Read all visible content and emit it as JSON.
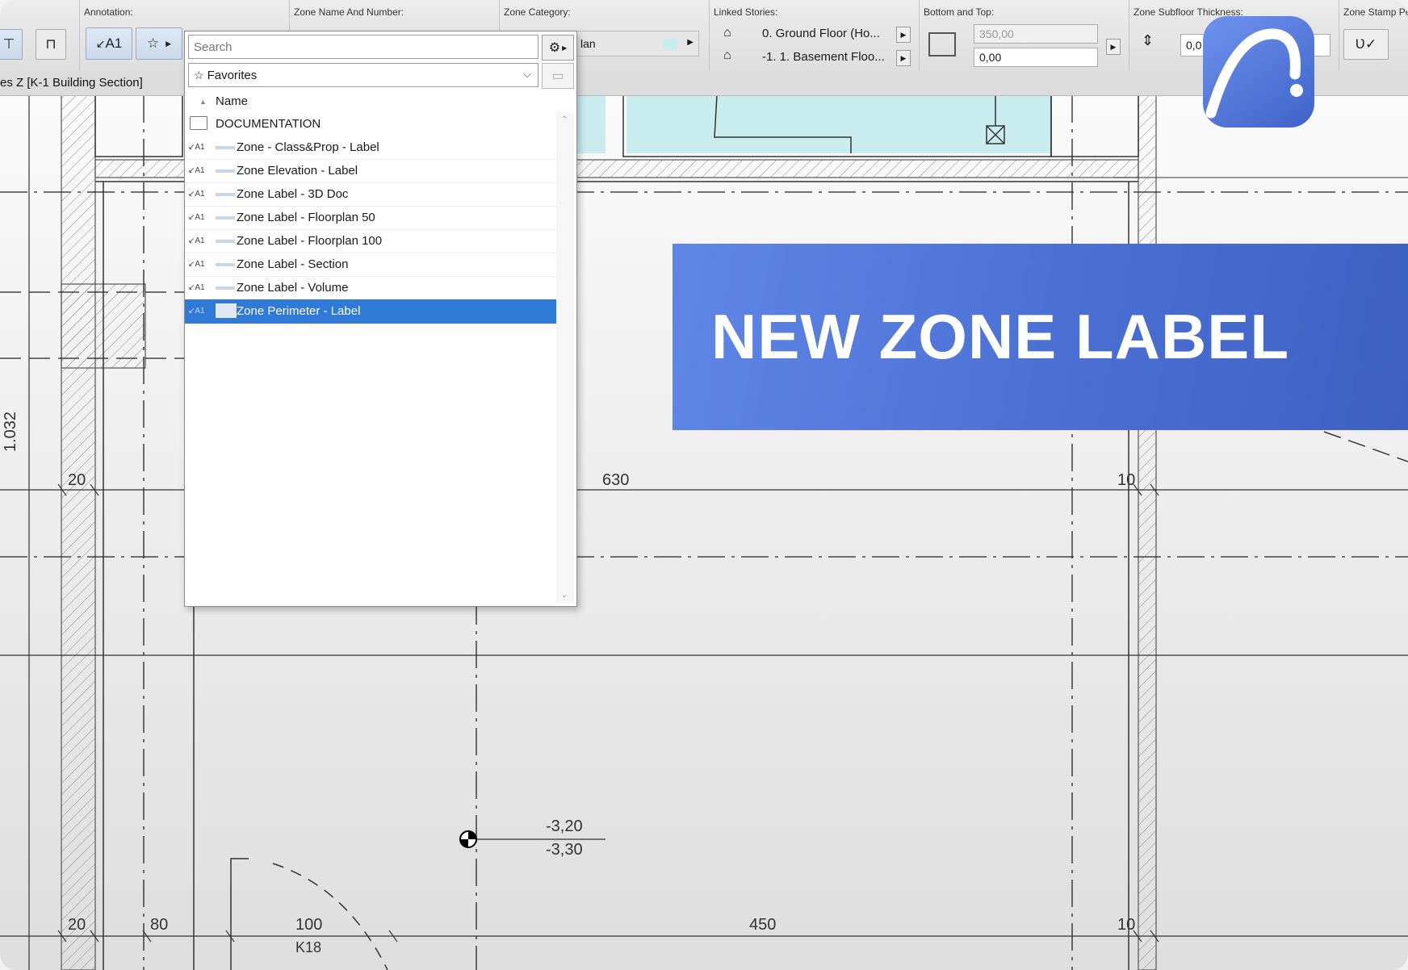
{
  "toolbar": {
    "annotation_label": "Annotation:",
    "annotation_btn": "A1",
    "zone_name_label": "Zone Name And Number:",
    "zone_category_label": "Zone Category:",
    "zone_category_value": "lan",
    "linked_stories_label": "Linked Stories:",
    "story_top": "0. Ground Floor (Ho...",
    "story_bottom": "-1. 1. Basement Floo...",
    "bottom_top_label": "Bottom and Top:",
    "top_value": "350,00",
    "bottom_value": "0,00",
    "subfloor_label": "Zone Subfloor Thickness:",
    "subfloor_value": "0,0",
    "stamp_label": "Zone Stamp Pe"
  },
  "path_bar": "es Z [K-1 Building Section]",
  "dropdown": {
    "search_placeholder": "Search",
    "favorites": "Favorites",
    "column_name": "Name",
    "folder": "DOCUMENTATION",
    "item_type": "A1",
    "items": [
      "Zone - Class&Prop - Label",
      "Zone Elevation - Label",
      "Zone Label - 3D Doc",
      "Zone Label - Floorplan 50",
      "Zone Label - Floorplan 100",
      "Zone Label - Section",
      "Zone Label - Volume",
      "Zone Perimeter - Label"
    ],
    "selected_index": 7
  },
  "banner": "NEW ZONE LABEL",
  "drawing": {
    "dims_top": [
      "20",
      "630",
      "10"
    ],
    "dims_bottom": [
      "20",
      "80",
      "100",
      "450",
      "10"
    ],
    "vertical_dim": "1.032",
    "level_top": "-3,20",
    "level_bottom": "-3,30",
    "door_tag": "K18"
  },
  "colors": {
    "selection": "#2f7ad6",
    "banner": "#4a6fd4",
    "zone_fill": "#c9ecef"
  }
}
